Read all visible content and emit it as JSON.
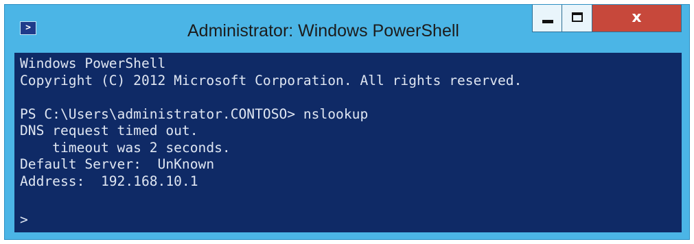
{
  "window": {
    "title": "Administrator: Windows PowerShell",
    "icon": "powershell-icon",
    "controls": {
      "minimize": "minimize-icon",
      "maximize": "maximize-icon",
      "close_label": "x"
    }
  },
  "console": {
    "lines": [
      "Windows PowerShell",
      "Copyright (C) 2012 Microsoft Corporation. All rights reserved.",
      "",
      "PS C:\\Users\\administrator.CONTOSO> nslookup",
      "DNS request timed out.",
      "    timeout was 2 seconds.",
      "Default Server:  UnKnown",
      "Address:  192.168.10.1"
    ],
    "prompt": ">"
  },
  "colors": {
    "frame": "#4bb5e6",
    "console_background": "#0f2a66",
    "console_text": "#dfe6f2",
    "close_button": "#c7483b"
  }
}
